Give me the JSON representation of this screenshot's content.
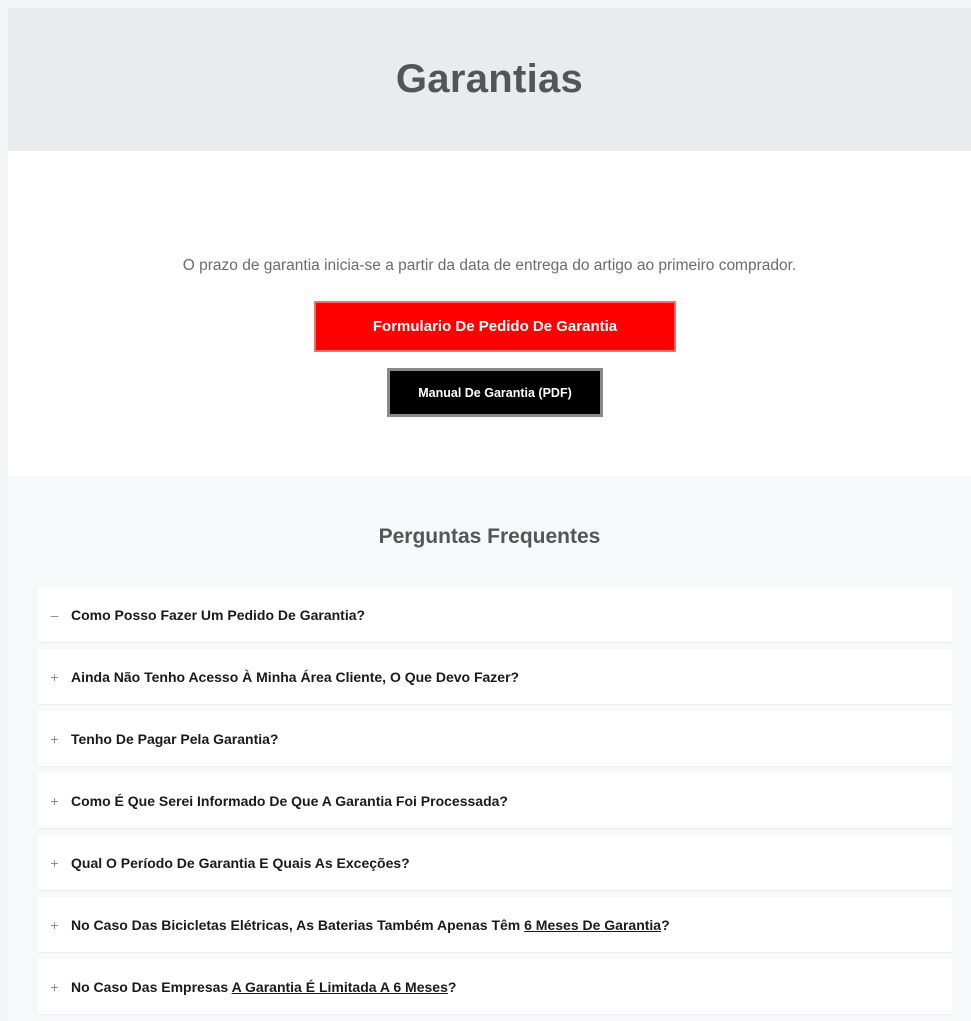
{
  "header": {
    "title": "Garantias"
  },
  "intro": {
    "text": "O prazo de garantia inicia-se a partir da data de entrega do artigo ao primeiro comprador.",
    "primary_button": "Formulario De Pedido De Garantia",
    "secondary_button": "Manual De Garantia (PDF)"
  },
  "faq": {
    "title": "Perguntas Frequentes",
    "items": [
      {
        "toggle": "–",
        "prefix": "Como Posso Fazer Um Pedido De Garantia?",
        "link": "",
        "suffix": "",
        "expanded": true
      },
      {
        "toggle": "+",
        "prefix": "Ainda Não Tenho Acesso À Minha Área Cliente, O Que Devo Fazer?",
        "link": "",
        "suffix": "",
        "expanded": false
      },
      {
        "toggle": "+",
        "prefix": "Tenho De Pagar Pela Garantia?",
        "link": "",
        "suffix": "",
        "expanded": false
      },
      {
        "toggle": "+",
        "prefix": "Como É Que Serei Informado De Que A Garantia Foi Processada?",
        "link": "",
        "suffix": "",
        "expanded": false
      },
      {
        "toggle": "+",
        "prefix": "Qual O Período De Garantia E Quais As Exceções?",
        "link": "",
        "suffix": "",
        "expanded": false
      },
      {
        "toggle": "+",
        "prefix": "No Caso Das Bicicletas Elétricas, As Baterias Também Apenas Têm ",
        "link": "6 Meses De Garantia",
        "suffix": "?",
        "expanded": false
      },
      {
        "toggle": "+",
        "prefix": "No Caso Das Empresas ",
        "link": "A Garantia É Limitada A 6 Meses",
        "suffix": "?",
        "expanded": false
      }
    ]
  },
  "colors": {
    "primary_button_bg": "#ff0000",
    "secondary_button_bg": "#000000",
    "hero_bg": "#e9ebed"
  }
}
